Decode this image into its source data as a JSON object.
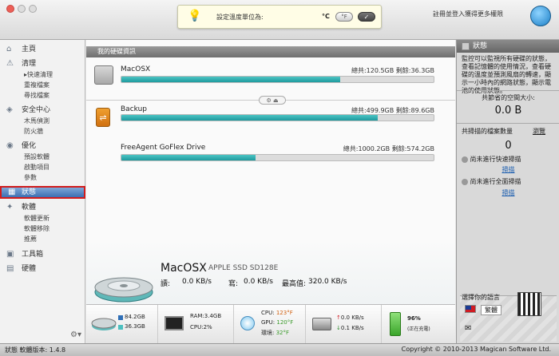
{
  "tip": {
    "text": "設定溫度單位為:",
    "celsius": "°C",
    "fahrenheit": "°F",
    "confirm": "✓"
  },
  "header": {
    "login": "註冊並登入獲得更多權限"
  },
  "sidebar": {
    "items": [
      {
        "label": "主頁",
        "icon": "home-icon"
      },
      {
        "label": "清理",
        "icon": "broom-icon"
      },
      {
        "label": "安全中心",
        "icon": "shield-icon"
      },
      {
        "label": "優化",
        "icon": "rocket-icon"
      },
      {
        "label": "狀態",
        "icon": "chart-icon"
      },
      {
        "label": "軟體",
        "icon": "apps-icon"
      },
      {
        "label": "工具箱",
        "icon": "toolbox-icon"
      },
      {
        "label": "硬體",
        "icon": "chip-icon"
      }
    ],
    "sub_clean": [
      "快速清理",
      "重複檔案",
      "尋找檔案"
    ],
    "sub_security": [
      "木馬偵測",
      "防火牆"
    ],
    "sub_optimize": [
      "預設軟體",
      "啟動項目",
      "參數"
    ],
    "sub_software": [
      "軟體更新",
      "軟體移除",
      "推薦"
    ]
  },
  "main": {
    "section_title": "我的硬碟資訊",
    "drives": [
      {
        "name": "MacOSX",
        "total": "總共:120.5GB",
        "free": "剩餘:36.3GB",
        "used_fraction": 0.7
      },
      {
        "name": "Backup",
        "total": "總共:499.9GB",
        "free": "剩餘:89.6GB",
        "used_fraction": 0.82
      },
      {
        "name": "FreeAgent GoFlex Drive",
        "total": "總共:1000.2GB",
        "free": "剩餘:574.2GB",
        "used_fraction": 0.43
      }
    ],
    "detail": {
      "name": "MacOSX",
      "model": "APPLE SSD SD128E",
      "read_label": "讀:",
      "read_value": "0.0 KB/s",
      "write_label": "寫:",
      "write_value": "0.0 KB/s",
      "peak_label": "最高值:",
      "peak_value": "320.0 KB/s"
    }
  },
  "bottombar": {
    "disk_used": "84.2GB",
    "disk_free": "36.3GB",
    "ram": "RAM:3.4GB",
    "cpu_pct": "CPU:2%",
    "cpu_temp_label": "CPU:",
    "cpu_temp": "123°F",
    "gpu_temp_label": "GPU:",
    "gpu_temp": "120°F",
    "env_temp_label": "環境:",
    "env_temp": "32°F",
    "net_up": "0.0 KB/s",
    "net_down": "0.1 KB/s",
    "battery_pct": "96%",
    "battery_state": "(正在充電)"
  },
  "right": {
    "title": "狀態",
    "description": "監控可以監視所有硬碟的狀態，查看記憶體的使用情況，查看硬碟的溫度並預測風扇的轉速，顯示一小時內的網路狀態，顯示電池的使用狀態。",
    "saved_label": "共節省的空間大小:",
    "saved_value": "0.0 B",
    "scanned_label": "共掃描的檔案數量",
    "scanned_link": "瀏覽",
    "scanned_value": "0",
    "quick_scan": "尚未進行快速掃描",
    "quick_scan_link": "掃描",
    "full_scan": "尚未進行全面掃描",
    "full_scan_link": "掃描",
    "lang_label": "選擇你的語言",
    "lang_value": "繁體"
  },
  "status": {
    "version": "狀態 軟體版本: 1.4.8",
    "copyright": "Copyright © 2010-2013 Magican Software Ltd."
  }
}
